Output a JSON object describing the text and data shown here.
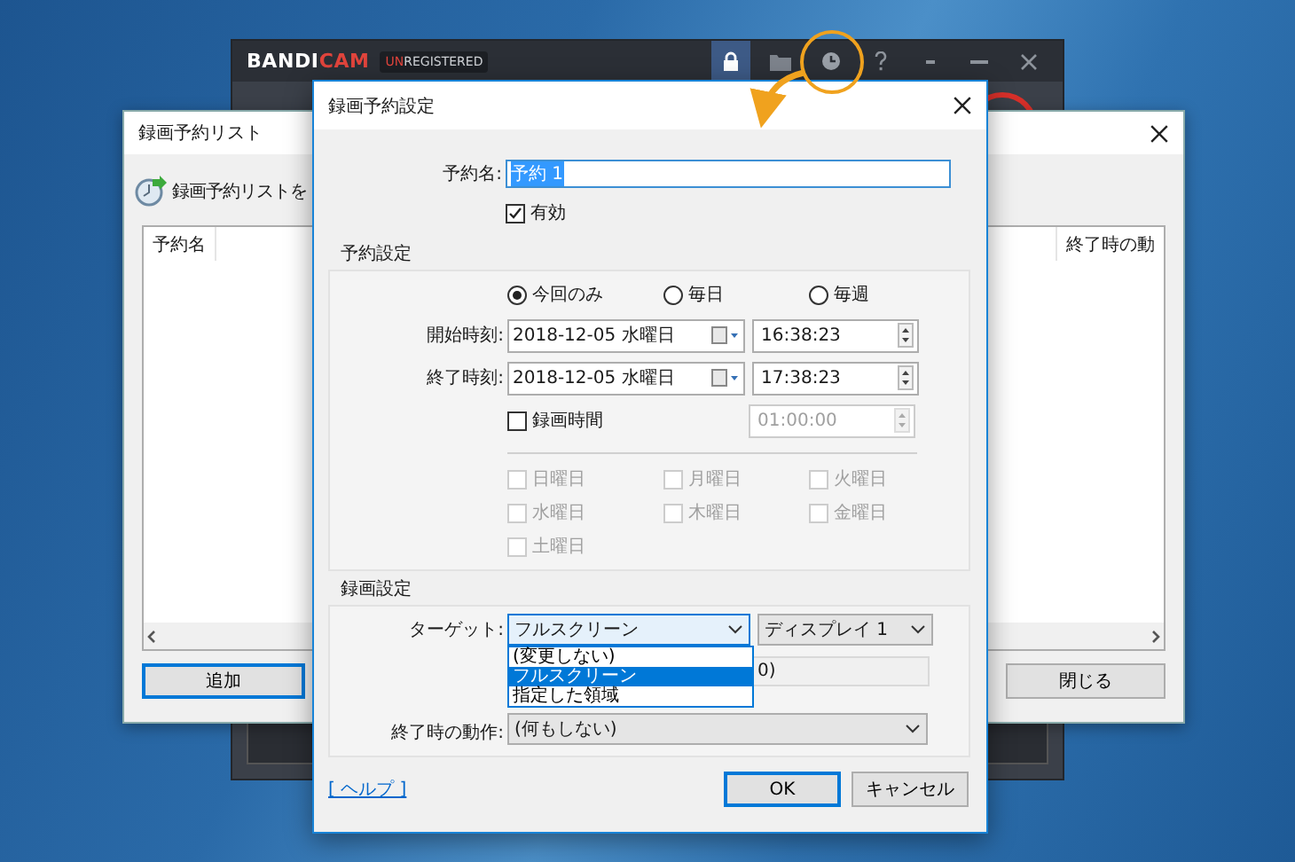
{
  "main_window": {
    "logo": [
      "BANDI",
      "CAM"
    ],
    "badge": [
      "UN",
      "REGISTERED"
    ]
  },
  "list_window": {
    "title": "録画予約リスト",
    "heading": "録画予約リストを",
    "columns": [
      "予約名",
      "終了時の動"
    ],
    "buttons": [
      {
        "label": "追加",
        "default": true
      },
      {
        "label": "閉じる",
        "default": false
      }
    ]
  },
  "dialog": {
    "title": "録画予約設定",
    "name": {
      "label": "予約名:",
      "value": "予約 1",
      "highlighted": true
    },
    "enabled": {
      "label": "有効",
      "checked": true
    },
    "schedule": {
      "title": "予約設定",
      "repeat": [
        {
          "label": "今回のみ",
          "selected": true
        },
        {
          "label": "毎日",
          "selected": false
        },
        {
          "label": "毎週",
          "selected": false
        }
      ],
      "start": {
        "label": "開始時刻:",
        "date": "2018-12-05 水曜日",
        "time": "16:38:23"
      },
      "end": {
        "label": "終了時刻:",
        "date": "2018-12-05 水曜日",
        "time": "17:38:23"
      },
      "duration": {
        "label": "録画時間",
        "checked": false,
        "time": "01:00:00",
        "disabled": true
      },
      "weekdays": [
        {
          "label": "日曜日",
          "checked": false,
          "disabled": true
        },
        {
          "label": "月曜日",
          "checked": false,
          "disabled": true
        },
        {
          "label": "火曜日",
          "checked": false,
          "disabled": true
        },
        {
          "label": "水曜日",
          "checked": false,
          "disabled": true
        },
        {
          "label": "木曜日",
          "checked": false,
          "disabled": true
        },
        {
          "label": "金曜日",
          "checked": false,
          "disabled": true
        },
        {
          "label": "土曜日",
          "checked": false,
          "disabled": true
        }
      ]
    },
    "recording": {
      "title": "録画設定",
      "target": {
        "label": "ターゲット:",
        "value": "フルスクリーン",
        "display": "ディスプレイ 1",
        "open": true,
        "options": [
          {
            "label": "(変更しない)",
            "selected": false
          },
          {
            "label": "フルスクリーン",
            "selected": true
          },
          {
            "label": "指定した領域",
            "selected": false
          }
        ]
      },
      "region_value": "0)",
      "end_action": {
        "label": "終了時の動作:",
        "value": "(何もしない)"
      }
    },
    "help_link": "[ ヘルプ ]",
    "buttons": [
      {
        "label": "OK",
        "default": true
      },
      {
        "label": "キャンセル",
        "default": false
      }
    ]
  }
}
